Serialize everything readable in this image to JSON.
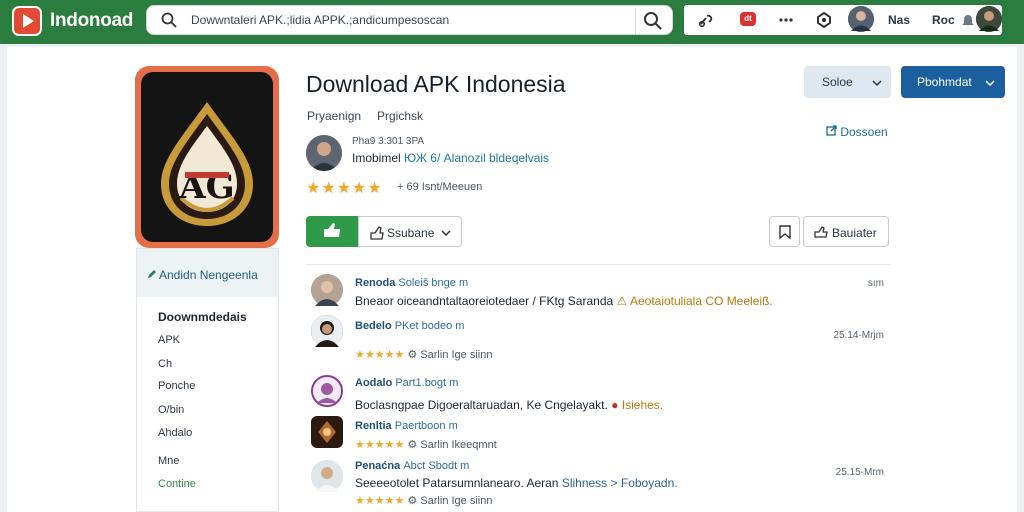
{
  "topbar": {
    "logo_text": "Indonoad",
    "search_text": "Dowwntaleri APK.;lidia APPK.;andicumpesoscan",
    "tool_badge": "dt",
    "user1": "Nas",
    "user2": "Roc",
    "accent": "#2a7d3e"
  },
  "sidebar": {
    "title": "Andidn Nengeenla",
    "heading": "Doownmdedais",
    "items": [
      "APK",
      "Ch",
      "Ponche",
      "O/bin",
      "Ahdalo",
      "Mne",
      "Contine"
    ]
  },
  "app": {
    "title": "Download APK Indonesia",
    "sub_a": "Pryaenign",
    "sub_b": "Prgichsk",
    "dev_meta": "Pha9 3:301 3PA",
    "dev_name_a": "Imobimel",
    "dev_name_b": "ЮЖ 6/ Alanozil bldeqelvais",
    "rating_text": "+ 69 Isnt/Meeuen",
    "rating_stars": "★★★★★"
  },
  "actions": {
    "share_label": "Ssubane",
    "report_label": "Bauiater",
    "select_label": "Soloe",
    "primary_label": "Pbohmdat",
    "doc_label": "Dossoen"
  },
  "reviews": [
    {
      "name": "Renoda",
      "handle": "Soleiš bnge m",
      "time": "sım",
      "text_a": "Bneaor oiceandntaltaoreiotedaer / FKtg Saranda",
      "text_b": "Aeotaiotuliala CO Meeleiß."
    },
    {
      "name": "Bedelo",
      "handle": "PKet bodeo m",
      "time": "25.14-Mrjm",
      "stars": "★★★★★",
      "meta": "Sarlin Ige siinn"
    },
    {
      "name": "Aodalo",
      "handle": "Part1.bogt m",
      "text_a": "Boclasngpae Digoeraltaruadan, Ke Cngelayakt.",
      "text_b": "Isiehes."
    },
    {
      "name": "Renltia",
      "handle": "Paertboon m",
      "stars": "★★★★★",
      "meta": "Sarlin Ikeeqmnt"
    },
    {
      "name": "Penaćna",
      "handle": "Abct Sbodt m",
      "time": "25.15-Mrm",
      "text_a": "Seeeeotolet Patarsumnlanearo. Aeran",
      "text_b": "Slihness",
      "text_c": "Foboyadn.",
      "stars": "★★★★★",
      "meta": "Sarlin Ige siinn"
    }
  ]
}
